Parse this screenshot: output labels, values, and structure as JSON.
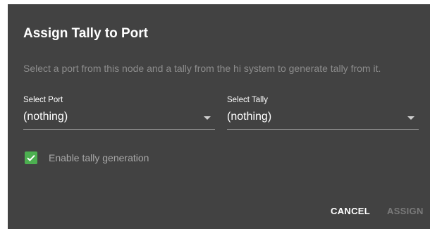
{
  "dialog": {
    "title": "Assign Tally to Port",
    "description": "Select a port from this node and a tally from the hi system to generate tally from it."
  },
  "port_select": {
    "label": "Select Port",
    "value": "(nothing)"
  },
  "tally_select": {
    "label": "Select Tally",
    "value": "(nothing)"
  },
  "enable_tally": {
    "label": "Enable tally generation",
    "checked": true
  },
  "actions": {
    "cancel_label": "CANCEL",
    "assign_label": "ASSIGN"
  },
  "colors": {
    "dialog_background": "#424242",
    "checkbox_accent": "#4caf50",
    "disabled_text": "#7a7a7a"
  },
  "icons": {
    "dropdown": "chevron-down-icon",
    "checkbox": "check-icon"
  }
}
